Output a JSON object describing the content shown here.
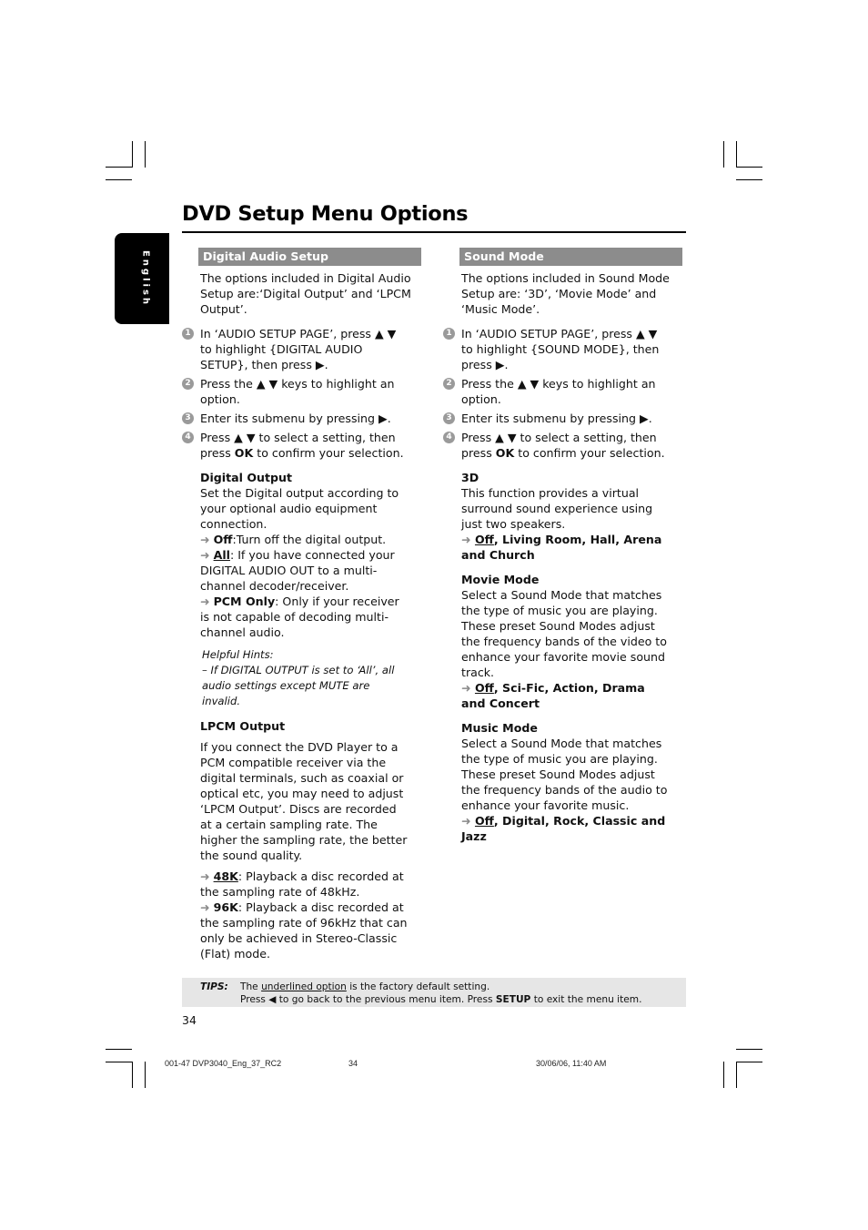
{
  "page": {
    "title": "DVD Setup Menu Options",
    "language_tab": "English",
    "page_number": "34"
  },
  "left": {
    "heading": "Digital Audio Setup",
    "intro": "The options included in Digital Audio Setup are:‘Digital Output’ and ‘LPCM Output’.",
    "steps": [
      {
        "num": "1",
        "text": "In ‘AUDIO SETUP PAGE’, press ▲ ▼ to highlight {DIGITAL AUDIO SETUP}, then press ▶."
      },
      {
        "num": "2",
        "text": "Press the ▲ ▼ keys to highlight an option."
      },
      {
        "num": "3",
        "text": "Enter its submenu by pressing ▶."
      },
      {
        "num": "4",
        "text_pre": "Press ▲ ▼ to select a setting, then press ",
        "text_bold": "OK",
        "text_post": " to confirm your selection."
      }
    ],
    "digital_output": {
      "heading": "Digital Output",
      "desc": "Set the Digital output according to your optional audio equipment connection.",
      "options": [
        {
          "name": "Off",
          "default": false,
          "desc": ":Turn off the digital output."
        },
        {
          "name": "All",
          "default": true,
          "desc": ": If you have connected your DIGITAL AUDIO OUT to a multi-channel decoder/receiver."
        },
        {
          "name": "PCM Only",
          "default": false,
          "desc": ": Only if your receiver is not capable of decoding multi-channel audio."
        }
      ]
    },
    "hints": {
      "title": "Helpful Hints:",
      "text": "–    If DIGITAL OUTPUT is set to ‘All’, all audio settings except MUTE are invalid."
    },
    "lpcm_output": {
      "heading": "LPCM Output",
      "desc": "If you connect the DVD Player to a PCM compatible receiver via the digital terminals, such as coaxial or optical etc, you may need to adjust ‘LPCM Output’. Discs are recorded at a certain sampling rate. The higher the sampling rate, the better the sound quality.",
      "options": [
        {
          "name": "48K",
          "default": true,
          "desc": ": Playback a disc recorded at the sampling rate of 48kHz."
        },
        {
          "name": "96K",
          "default": false,
          "desc": ": Playback a disc recorded at the sampling rate of 96kHz that can only be achieved in Stereo-Classic (Flat) mode."
        }
      ]
    }
  },
  "right": {
    "heading": "Sound Mode",
    "intro": "The options included in Sound Mode Setup are:  ‘3D’, ‘Movie Mode’ and ‘Music Mode’.",
    "steps": [
      {
        "num": "1",
        "text": "In ‘AUDIO SETUP PAGE’, press ▲ ▼ to highlight {SOUND MODE}, then press ▶."
      },
      {
        "num": "2",
        "text": "Press the ▲ ▼ keys to highlight an option."
      },
      {
        "num": "3",
        "text": "Enter its submenu by pressing ▶."
      },
      {
        "num": "4",
        "text_pre": "Press ▲ ▼ to select a setting, then press ",
        "text_bold": "OK",
        "text_post": " to confirm your selection."
      }
    ],
    "three_d": {
      "heading": "3D",
      "desc": "This function provides a virtual surround sound experience using just two speakers.",
      "default": "Off",
      "others": ", Living Room, Hall, Arena and Church"
    },
    "movie_mode": {
      "heading": "Movie Mode",
      "desc": "Select a Sound Mode that matches the type of music you are playing. These preset Sound Modes adjust the frequency bands of the video to enhance your favorite movie sound track.",
      "default": "Off",
      "others": ", Sci-Fic, Action, Drama and Concert"
    },
    "music_mode": {
      "heading": "Music Mode",
      "desc": "Select a Sound Mode that matches the type of music you are playing. These preset Sound Modes adjust the frequency bands of the audio to enhance your favorite music.",
      "default": "Off",
      "others": ", Digital, Rock, Classic and Jazz"
    }
  },
  "tips": {
    "label": "TIPS:",
    "line1_pre": "The ",
    "line1_u": "underlined option",
    "line1_post": " is the factory default setting.",
    "line2_pre": "Press ◀ to go back to the previous menu item. Press ",
    "line2_bold": "SETUP",
    "line2_post": " to exit the menu item."
  },
  "footer": {
    "file": "001-47 DVP3040_Eng_37_RC2",
    "page": "34",
    "date": "30/06/06, 11:40 AM"
  },
  "icons": {
    "arrow": "➜"
  }
}
